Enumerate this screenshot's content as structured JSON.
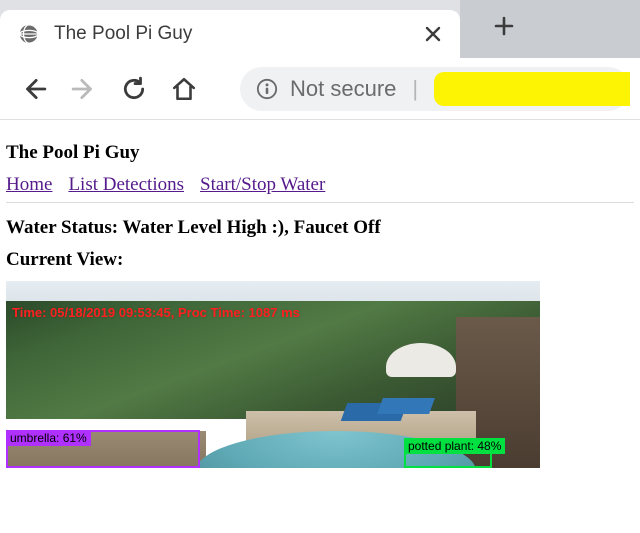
{
  "tab": {
    "title": "The Pool Pi Guy"
  },
  "addressbar": {
    "not_secure": "Not secure",
    "pipe": "|"
  },
  "page": {
    "heading": "The Pool Pi Guy",
    "nav": {
      "home": "Home",
      "list": "List Detections",
      "startstop": "Start/Stop Water"
    },
    "status_label": "Water Status: ",
    "status_value": "Water Level High :), Faucet Off",
    "view_label": "Current View:"
  },
  "camera": {
    "timestamp_line": "Time: 05/18/2019 09:53:45, Proc Time: 1087 ms",
    "detections": {
      "umbrella": "umbrella: 61%",
      "potted_plant": "potted plant: 48%"
    }
  }
}
